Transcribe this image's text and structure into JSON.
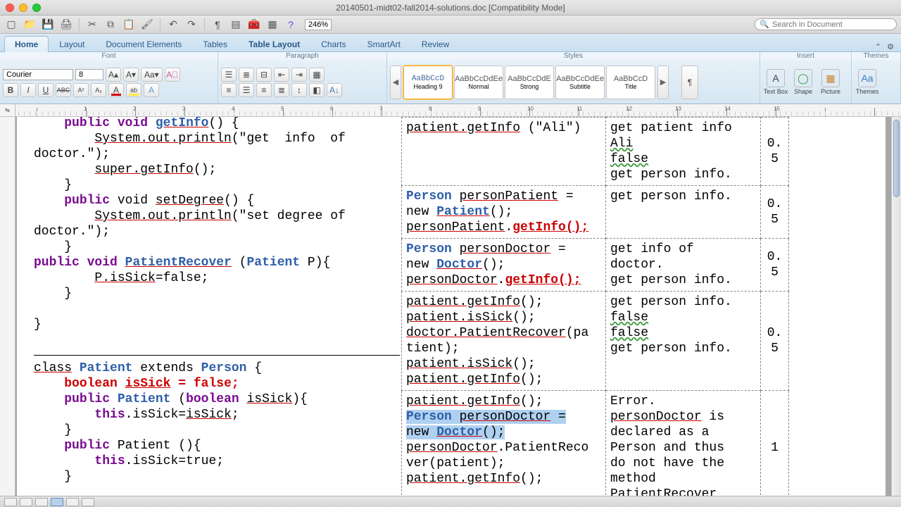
{
  "window": {
    "title": "20140501-midt02-fall2014-solutions.doc [Compatibility Mode]"
  },
  "qat": {
    "zoom": "246%",
    "search_placeholder": "Search in Document"
  },
  "tabs": {
    "home": "Home",
    "layout": "Layout",
    "docel": "Document Elements",
    "tables": "Tables",
    "tablelayout": "Table Layout",
    "charts": "Charts",
    "smartart": "SmartArt",
    "review": "Review"
  },
  "ribbon": {
    "groups": {
      "font": "Font",
      "paragraph": "Paragraph",
      "styles": "Styles",
      "insert": "Insert",
      "themes": "Themes"
    },
    "font_name": "Courier",
    "font_size": "8",
    "style_items": [
      {
        "samp": "AaBbCcD",
        "label": "Heading 9",
        "cls": "h9 sel"
      },
      {
        "samp": "AaBbCcDdEe",
        "label": "Normal",
        "cls": ""
      },
      {
        "samp": "AaBbCcDdE",
        "label": "Strong",
        "cls": ""
      },
      {
        "samp": "AaBbCcDdEe",
        "label": "Subtitle",
        "cls": ""
      },
      {
        "samp": "AaBbCcD",
        "label": "Title",
        "cls": ""
      }
    ],
    "insert_buttons": {
      "textbox": "Text Box",
      "shape": "Shape",
      "picture": "Picture",
      "themes": "Themes"
    }
  },
  "ruler_numbers": [
    "1",
    "2",
    "3",
    "4",
    "5",
    "6",
    "7",
    "8",
    "9",
    "10",
    "11",
    "12",
    "13",
    "14",
    "15"
  ],
  "code": {
    "block1_lines": [
      "    <span class='kw'>public</span> <span class='kw'>void</span> <span class='typ ul'>getInfo</span>() {",
      "        <span class='ul'>System.out.println</span>(\"get  info  of",
      "doctor.\");",
      "        <span class='ul'>super.getInfo</span>();",
      "    }",
      "    <span class='kw'>public</span> void <span class='ul'>setDegree</span>() {",
      "        <span class='ul'>System.out.println</span>(\"set degree of",
      "doctor.\");",
      "    }",
      "<span class='kw'>public</span> <span class='kw'>void</span> <span class='typ ul'>PatientRecover</span> (<span class='typ'>Patient</span> P){",
      "        <span class='ul'>P.isSick</span>=false;",
      "    }",
      "",
      "}"
    ],
    "block2_lines": [
      "<span class='ul'>class</span> <span class='typ'>Patient</span> extends <span class='typ'>Person</span> {",
      "    <span class='err'>boolean</span> <span class='err ul'>isSick</span> <span class='err'>= false;</span>",
      "    <span class='kw'>public</span> <span class='typ'>Patient</span> (<span class='kw'>boolean</span> <span class='ul'>isSick</span>){",
      "        <span class='kw'>this</span>.isSick=<span class='ul'>isSick</span>;",
      "    }",
      "    <span class='kw'>public</span> Patient (){",
      "        <span class='kw'>this</span>.isSick=true;",
      "    }"
    ]
  },
  "table_rows": [
    {
      "in": "<span class='ul'>patient.getInfo</span> (\"Ali\")",
      "out": "get patient info\n<span class='gram'>Ali</span>\n<span class='gram'>false</span>\nget person info.",
      "score": "0.5"
    },
    {
      "in": "<span class='typ'>Person</span> <span class='ul'>personPatient</span> =\nnew <span class='typ ul'>Patient</span>();\n<span class='ul'>personPatient</span>.<span class='err ul'>getInfo();</span>",
      "out": "get person info.",
      "score": "0.5"
    },
    {
      "in": "<span class='typ'>Person</span> <span class='ul'>personDoctor</span> =\nnew <span class='typ ul'>Doctor</span>();\n<span class='ul'>personDoctor</span>.<span class='err ul'>getInfo();</span>",
      "out": "get info of\ndoctor.\nget person info.",
      "score": "0.5"
    },
    {
      "in": "<span class='ul'>patient.getInfo</span>();\n<span class='ul'>patient.isSick</span>();\n<span class='ul'>doctor.PatientRecover</span>(pa\ntient);\n<span class='ul'>patient.isSick</span>();\n<span class='ul'>patient.getInfo</span>();",
      "out": "get person info.\n<span class='gram'>false</span>\n<span class='gram'>false</span>\nget person info.",
      "score": "0.5"
    },
    {
      "in": "<span class='ul'>patient.getInfo</span>();\n<span class='hl'><span class='typ'>Person</span> <span class='ul'>personDoctor</span> =</span>\n<span class='hl'>new <span class='typ ul'>Doctor</span>();</span>\n<span class='ul'>personDoctor</span>.PatientReco\nver(patient);\n<span class='ul'>patient.getInfo</span>();",
      "out": "Error.\n<span class='ul'>personDoctor</span> is\ndeclared as a\nPerson and thus\ndo not have the\nmethod\n<span class='ul'>PatientRecover</span>",
      "score": "1"
    }
  ]
}
